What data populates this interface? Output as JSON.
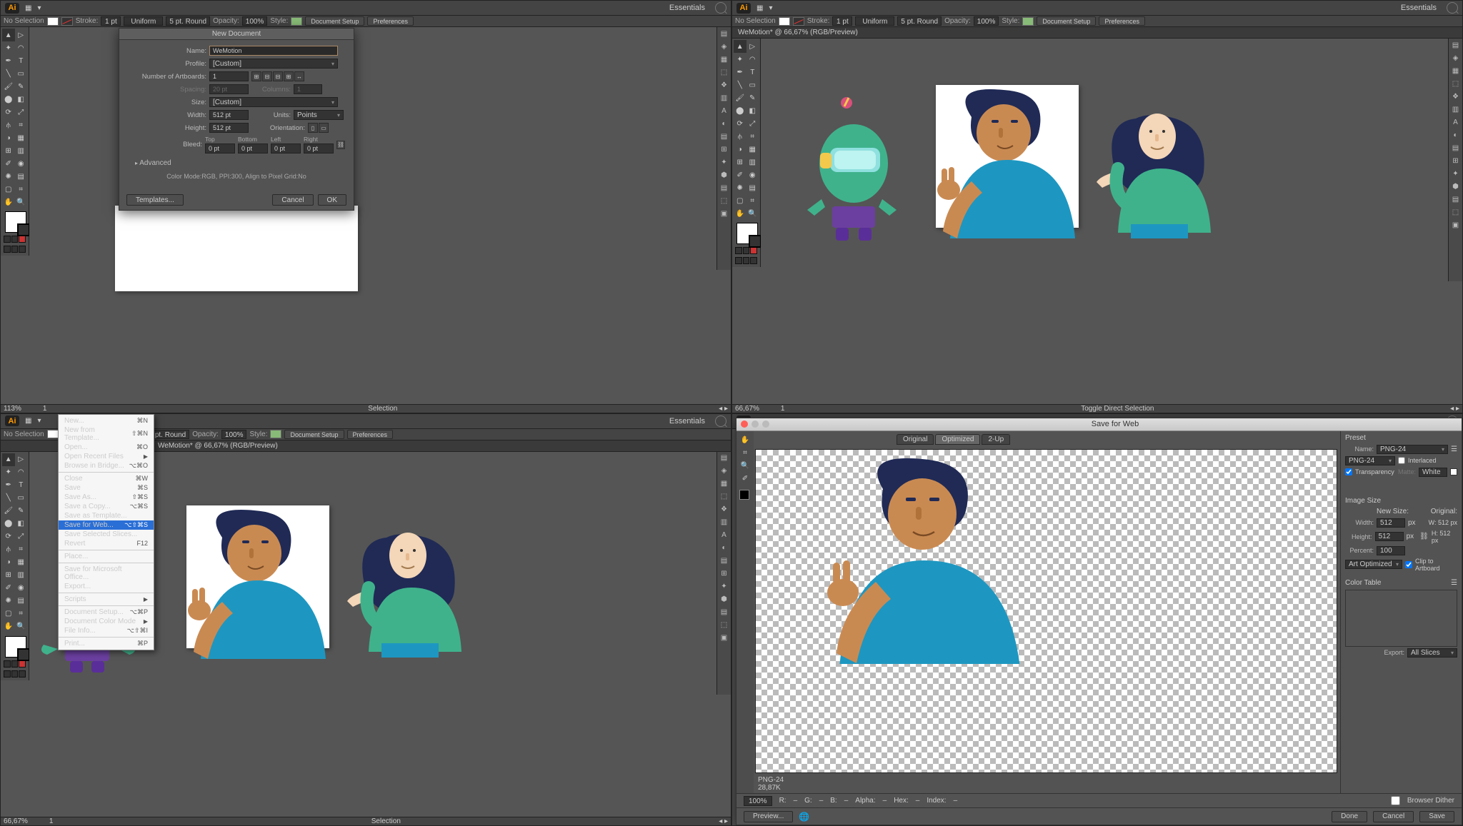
{
  "workspace": "Essentials",
  "ctrl": {
    "noSelection": "No Selection",
    "fill": "Fill:",
    "stroke": "Stroke:",
    "strokeVal": "1 pt",
    "profile": "Uniform",
    "brush": "5 pt. Round",
    "opacity": "Opacity:",
    "opacityVal": "100%",
    "style": "Style:",
    "docSetup": "Document Setup",
    "prefs": "Preferences"
  },
  "pane2": {
    "doc": "WeMotion* @ 66,67% (RGB/Preview)",
    "zoom": "66,67%",
    "tool": "Toggle Direct Selection"
  },
  "pane3": {
    "doc": "WeMotion* @ 66,67% (RGB/Preview)",
    "zoom": "66,67%",
    "tool": "Selection"
  },
  "pane1": {
    "zoom": "113%",
    "tool": "Selection"
  },
  "newDoc": {
    "title": "New Document",
    "labels": {
      "name": "Name:",
      "profile": "Profile:",
      "artboards": "Number of Artboards:",
      "spacing": "Spacing:",
      "columns": "Columns:",
      "size": "Size:",
      "width": "Width:",
      "height": "Height:",
      "units": "Units:",
      "orient": "Orientation:",
      "bleed": "Bleed:"
    },
    "name": "WeMotion",
    "profile": "[Custom]",
    "artboards": "1",
    "spacing": "20 pt",
    "columns": "1",
    "size": "[Custom]",
    "width": "512 pt",
    "height": "512 pt",
    "units": "Points",
    "bleedTop": "Top",
    "bleedBottom": "Bottom",
    "bleedLeft": "Left",
    "bleedRight": "Right",
    "bleedVal": "0 pt",
    "advanced": "Advanced",
    "mode": "Color Mode:RGB, PPI:300, Align to Pixel Grid:No",
    "templates": "Templates...",
    "cancel": "Cancel",
    "ok": "OK"
  },
  "fileMenu": [
    {
      "label": "New...",
      "k": "⌘N"
    },
    {
      "label": "New from Template...",
      "k": "⇧⌘N"
    },
    {
      "label": "Open...",
      "k": "⌘O"
    },
    {
      "label": "Open Recent Files",
      "arrow": true,
      "dis": true
    },
    {
      "label": "Browse in Bridge...",
      "k": "⌥⌘O"
    },
    {
      "sep": true
    },
    {
      "label": "Close",
      "k": "⌘W"
    },
    {
      "label": "Save",
      "k": "⌘S"
    },
    {
      "label": "Save As...",
      "k": "⇧⌘S"
    },
    {
      "label": "Save a Copy...",
      "k": "⌥⌘S"
    },
    {
      "label": "Save as Template..."
    },
    {
      "label": "Save for Web...",
      "k": "⌥⇧⌘S",
      "sel": true
    },
    {
      "label": "Save Selected Slices..."
    },
    {
      "label": "Revert",
      "k": "F12",
      "dis": true
    },
    {
      "sep": true
    },
    {
      "label": "Place..."
    },
    {
      "sep": true
    },
    {
      "label": "Save for Microsoft Office..."
    },
    {
      "label": "Export..."
    },
    {
      "sep": true
    },
    {
      "label": "Scripts",
      "arrow": true
    },
    {
      "sep": true
    },
    {
      "label": "Document Setup...",
      "k": "⌥⌘P"
    },
    {
      "label": "Document Color Mode",
      "arrow": true
    },
    {
      "label": "File Info...",
      "k": "⌥⇧⌘I"
    },
    {
      "sep": true
    },
    {
      "label": "Print...",
      "k": "⌘P"
    }
  ],
  "sfw": {
    "title": "Save for Web",
    "tabs": [
      "Original",
      "Optimized",
      "2-Up"
    ],
    "activeTab": 1,
    "presetLbl": "Preset",
    "nameLbl": "Name:",
    "name": "PNG-24",
    "format": "PNG-24",
    "interlaced": "Interlaced",
    "transparency": "Transparency",
    "matte": "Matte:",
    "matteVal": "White",
    "imgSize": "Image Size",
    "newSize": "New Size:",
    "original": "Original:",
    "widthLbl": "Width:",
    "heightLbl": "Height:",
    "width": "512",
    "height": "512",
    "px": "px",
    "origW": "W:  512 px",
    "origH": "H:  512 px",
    "percentLbl": "Percent:",
    "percent": "100",
    "quality": "Art Optimized",
    "clip": "Clip to Artboard",
    "colorTable": "Color Table",
    "info1": "PNG-24",
    "info2": "28,87K",
    "zoom": "100%",
    "R": "R:",
    "G": "G:",
    "B": "B:",
    "Alpha": "Alpha:",
    "Hex": "Hex:",
    "Index": "Index:",
    "browserDither": "Browser Dither",
    "exportLbl": "Export:",
    "exportSel": "All Slices",
    "preview": "Preview...",
    "done": "Done",
    "cancel": "Cancel",
    "save": "Save"
  }
}
